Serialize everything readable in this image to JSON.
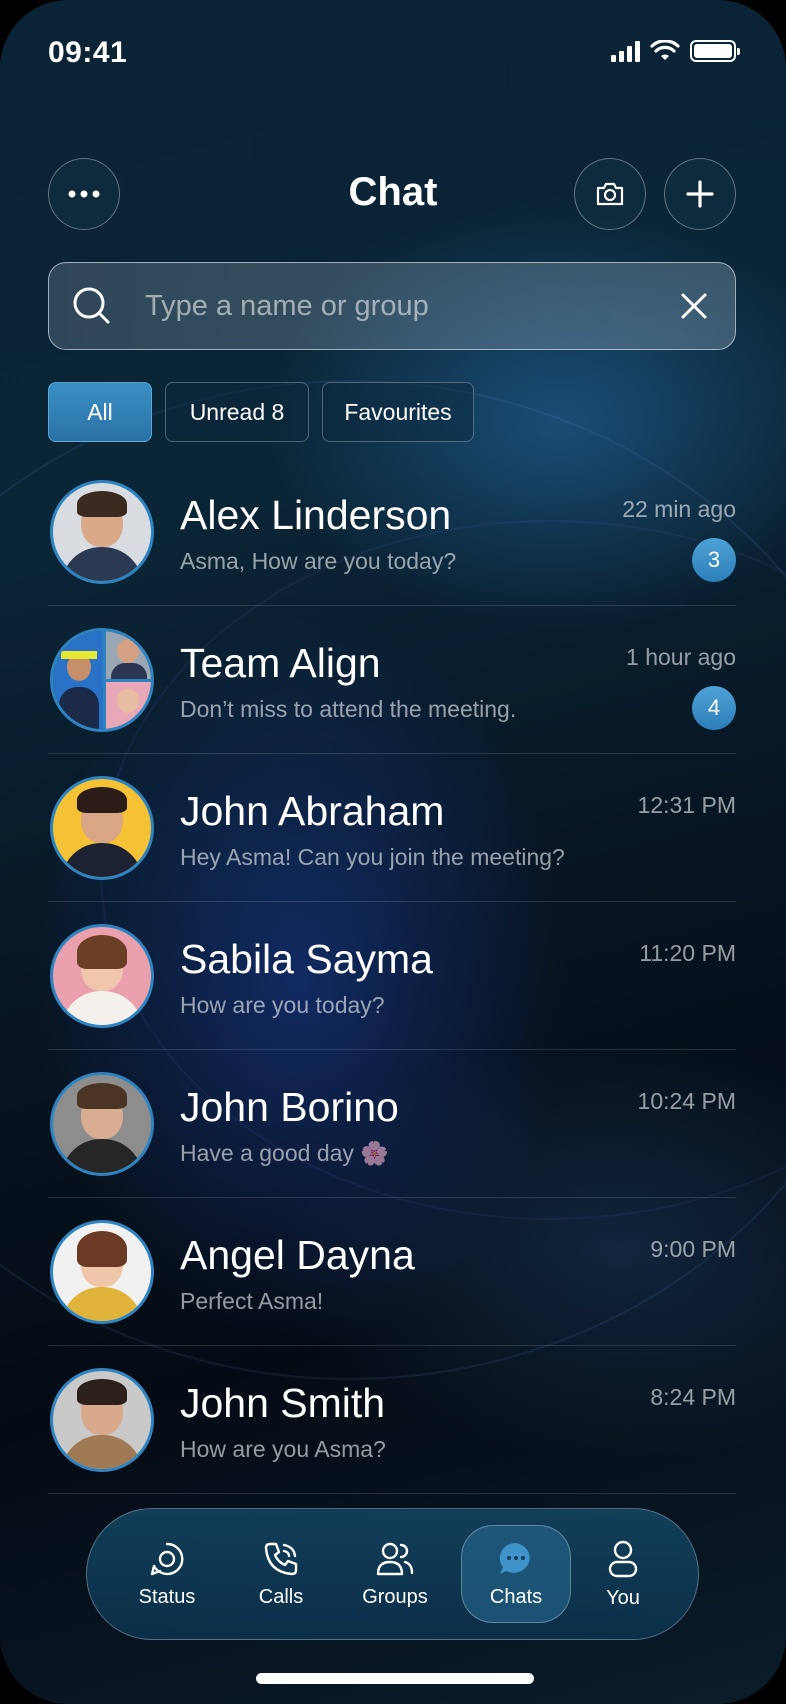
{
  "status_bar": {
    "time": "09:41"
  },
  "header": {
    "title": "Chat"
  },
  "search": {
    "placeholder": "Type a name or group",
    "value": ""
  },
  "filters": [
    {
      "label": "All",
      "active": true
    },
    {
      "label": "Unread 8",
      "active": false
    },
    {
      "label": "Favourites",
      "active": false
    }
  ],
  "chats": [
    {
      "name": "Alex Linderson",
      "message": "Asma, How are you today?",
      "time": "22 min ago",
      "unread": "3"
    },
    {
      "name": "Team Align",
      "message": "Don’t miss to attend the meeting.",
      "time": "1 hour ago",
      "unread": "4"
    },
    {
      "name": "John Abraham",
      "message": "Hey Asma! Can you join the meeting?",
      "time": "12:31 PM",
      "unread": ""
    },
    {
      "name": "Sabila Sayma",
      "message": "How are you today?",
      "time": "11:20 PM",
      "unread": ""
    },
    {
      "name": "John Borino",
      "message": "Have a good day 🌸",
      "time": "10:24 PM",
      "unread": ""
    },
    {
      "name": "Angel Dayna",
      "message": "Perfect Asma!",
      "time": "9:00 PM",
      "unread": ""
    },
    {
      "name": "John Smith",
      "message": "How are you Asma?",
      "time": "8:24 PM",
      "unread": ""
    }
  ],
  "nav": [
    {
      "label": "Status",
      "icon": "status-icon",
      "active": false
    },
    {
      "label": "Calls",
      "icon": "phone-icon",
      "active": false
    },
    {
      "label": "Groups",
      "icon": "groups-icon",
      "active": false
    },
    {
      "label": "Chats",
      "icon": "chat-bubble-icon",
      "active": true
    },
    {
      "label": "You",
      "icon": "person-icon",
      "active": false
    }
  ],
  "colors": {
    "accent": "#2f84c0",
    "badge": "#3b92c9",
    "background": "#071421"
  }
}
